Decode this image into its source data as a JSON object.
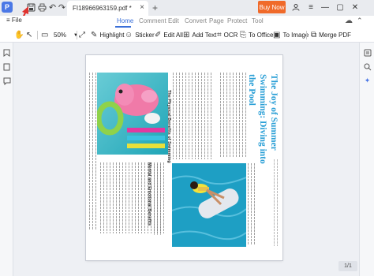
{
  "titlebar": {
    "app_icon_letter": "P",
    "doc_tab_name": "FI18966963159.pdf *",
    "buy_now": "Buy Now"
  },
  "menubar": {
    "file": "File",
    "tabs": [
      {
        "label": "Home",
        "active": true
      },
      {
        "label": "Comment",
        "active": false
      },
      {
        "label": "Edit",
        "active": false
      },
      {
        "label": "Convert",
        "active": false
      },
      {
        "label": "Page",
        "active": false
      },
      {
        "label": "Protect",
        "active": false
      },
      {
        "label": "Tool",
        "active": false
      }
    ]
  },
  "toolbar": {
    "zoom": "50%",
    "highlight": "Highlight",
    "sticker": "Sticker",
    "edit_all": "Edit All",
    "add_text": "Add Text",
    "ocr": "OCR",
    "to_office": "To Office",
    "to_image": "To Image",
    "merge_pdf": "Merge PDF"
  },
  "document": {
    "title_lines": [
      "The Joy of Summer",
      "Swimming: Diving into",
      "the Pool"
    ],
    "heading_physical": "The Physical Benefits of Swimming",
    "heading_mental": "Mental and Emotional Benefits"
  },
  "status": {
    "page_count": "1/1"
  },
  "colors": {
    "accent": "#3a6fd8",
    "buy_now": "#f06a2a",
    "title_text": "#2a9fd6",
    "annotation_arrow": "#e0322e"
  }
}
